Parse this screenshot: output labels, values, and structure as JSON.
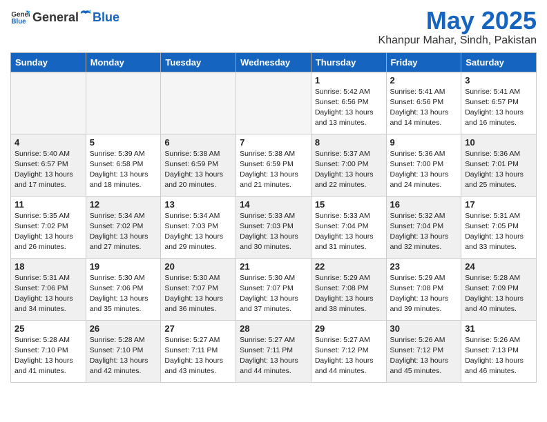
{
  "header": {
    "logo_general": "General",
    "logo_blue": "Blue",
    "month_title": "May 2025",
    "location": "Khanpur Mahar, Sindh, Pakistan"
  },
  "weekdays": [
    "Sunday",
    "Monday",
    "Tuesday",
    "Wednesday",
    "Thursday",
    "Friday",
    "Saturday"
  ],
  "weeks": [
    [
      {
        "day": "",
        "info": "",
        "empty": true
      },
      {
        "day": "",
        "info": "",
        "empty": true
      },
      {
        "day": "",
        "info": "",
        "empty": true
      },
      {
        "day": "",
        "info": "",
        "empty": true
      },
      {
        "day": "1",
        "info": "Sunrise: 5:42 AM\nSunset: 6:56 PM\nDaylight: 13 hours\nand 13 minutes."
      },
      {
        "day": "2",
        "info": "Sunrise: 5:41 AM\nSunset: 6:56 PM\nDaylight: 13 hours\nand 14 minutes."
      },
      {
        "day": "3",
        "info": "Sunrise: 5:41 AM\nSunset: 6:57 PM\nDaylight: 13 hours\nand 16 minutes."
      }
    ],
    [
      {
        "day": "4",
        "info": "Sunrise: 5:40 AM\nSunset: 6:57 PM\nDaylight: 13 hours\nand 17 minutes.",
        "shaded": true
      },
      {
        "day": "5",
        "info": "Sunrise: 5:39 AM\nSunset: 6:58 PM\nDaylight: 13 hours\nand 18 minutes."
      },
      {
        "day": "6",
        "info": "Sunrise: 5:38 AM\nSunset: 6:59 PM\nDaylight: 13 hours\nand 20 minutes.",
        "shaded": true
      },
      {
        "day": "7",
        "info": "Sunrise: 5:38 AM\nSunset: 6:59 PM\nDaylight: 13 hours\nand 21 minutes."
      },
      {
        "day": "8",
        "info": "Sunrise: 5:37 AM\nSunset: 7:00 PM\nDaylight: 13 hours\nand 22 minutes.",
        "shaded": true
      },
      {
        "day": "9",
        "info": "Sunrise: 5:36 AM\nSunset: 7:00 PM\nDaylight: 13 hours\nand 24 minutes."
      },
      {
        "day": "10",
        "info": "Sunrise: 5:36 AM\nSunset: 7:01 PM\nDaylight: 13 hours\nand 25 minutes.",
        "shaded": true
      }
    ],
    [
      {
        "day": "11",
        "info": "Sunrise: 5:35 AM\nSunset: 7:02 PM\nDaylight: 13 hours\nand 26 minutes."
      },
      {
        "day": "12",
        "info": "Sunrise: 5:34 AM\nSunset: 7:02 PM\nDaylight: 13 hours\nand 27 minutes.",
        "shaded": true
      },
      {
        "day": "13",
        "info": "Sunrise: 5:34 AM\nSunset: 7:03 PM\nDaylight: 13 hours\nand 29 minutes."
      },
      {
        "day": "14",
        "info": "Sunrise: 5:33 AM\nSunset: 7:03 PM\nDaylight: 13 hours\nand 30 minutes.",
        "shaded": true
      },
      {
        "day": "15",
        "info": "Sunrise: 5:33 AM\nSunset: 7:04 PM\nDaylight: 13 hours\nand 31 minutes."
      },
      {
        "day": "16",
        "info": "Sunrise: 5:32 AM\nSunset: 7:04 PM\nDaylight: 13 hours\nand 32 minutes.",
        "shaded": true
      },
      {
        "day": "17",
        "info": "Sunrise: 5:31 AM\nSunset: 7:05 PM\nDaylight: 13 hours\nand 33 minutes."
      }
    ],
    [
      {
        "day": "18",
        "info": "Sunrise: 5:31 AM\nSunset: 7:06 PM\nDaylight: 13 hours\nand 34 minutes.",
        "shaded": true
      },
      {
        "day": "19",
        "info": "Sunrise: 5:30 AM\nSunset: 7:06 PM\nDaylight: 13 hours\nand 35 minutes."
      },
      {
        "day": "20",
        "info": "Sunrise: 5:30 AM\nSunset: 7:07 PM\nDaylight: 13 hours\nand 36 minutes.",
        "shaded": true
      },
      {
        "day": "21",
        "info": "Sunrise: 5:30 AM\nSunset: 7:07 PM\nDaylight: 13 hours\nand 37 minutes."
      },
      {
        "day": "22",
        "info": "Sunrise: 5:29 AM\nSunset: 7:08 PM\nDaylight: 13 hours\nand 38 minutes.",
        "shaded": true
      },
      {
        "day": "23",
        "info": "Sunrise: 5:29 AM\nSunset: 7:08 PM\nDaylight: 13 hours\nand 39 minutes."
      },
      {
        "day": "24",
        "info": "Sunrise: 5:28 AM\nSunset: 7:09 PM\nDaylight: 13 hours\nand 40 minutes.",
        "shaded": true
      }
    ],
    [
      {
        "day": "25",
        "info": "Sunrise: 5:28 AM\nSunset: 7:10 PM\nDaylight: 13 hours\nand 41 minutes."
      },
      {
        "day": "26",
        "info": "Sunrise: 5:28 AM\nSunset: 7:10 PM\nDaylight: 13 hours\nand 42 minutes.",
        "shaded": true
      },
      {
        "day": "27",
        "info": "Sunrise: 5:27 AM\nSunset: 7:11 PM\nDaylight: 13 hours\nand 43 minutes."
      },
      {
        "day": "28",
        "info": "Sunrise: 5:27 AM\nSunset: 7:11 PM\nDaylight: 13 hours\nand 44 minutes.",
        "shaded": true
      },
      {
        "day": "29",
        "info": "Sunrise: 5:27 AM\nSunset: 7:12 PM\nDaylight: 13 hours\nand 44 minutes."
      },
      {
        "day": "30",
        "info": "Sunrise: 5:26 AM\nSunset: 7:12 PM\nDaylight: 13 hours\nand 45 minutes.",
        "shaded": true
      },
      {
        "day": "31",
        "info": "Sunrise: 5:26 AM\nSunset: 7:13 PM\nDaylight: 13 hours\nand 46 minutes."
      }
    ]
  ]
}
